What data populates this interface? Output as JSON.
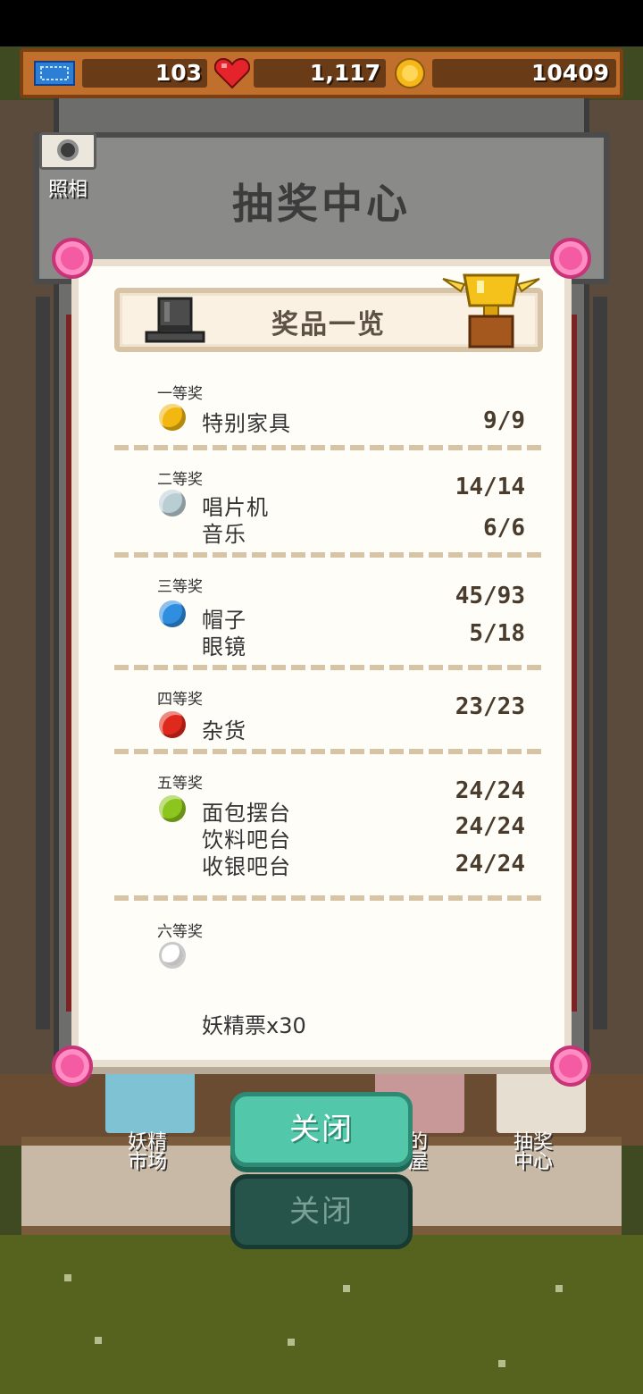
{
  "hud": {
    "tickets": "103",
    "hearts": "1,117",
    "coins": "10409"
  },
  "camera": {
    "label": "照相"
  },
  "scene": {
    "booth_title": "抽奖中心",
    "bottom_left_label": "妖精\n市场",
    "bottom_mid_label": "的\n屋",
    "bottom_right_label": "抽奖\n中心"
  },
  "modal": {
    "title": "奖品一览",
    "tiers": [
      {
        "label": "一等奖",
        "gem_color": "#f2b711",
        "items": [
          {
            "name": "特别家具",
            "count": "9/9"
          }
        ]
      },
      {
        "label": "二等奖",
        "gem_color": "#b9ced3",
        "items": [
          {
            "name": "唱片机",
            "count": "14/14"
          },
          {
            "name": "音乐",
            "count": "6/6"
          }
        ]
      },
      {
        "label": "三等奖",
        "gem_color": "#2f8ee0",
        "items": [
          {
            "name": "帽子",
            "count": "45/93"
          },
          {
            "name": "眼镜",
            "count": "5/18"
          }
        ]
      },
      {
        "label": "四等奖",
        "gem_color": "#e0291d",
        "items": [
          {
            "name": "杂货",
            "count": "23/23"
          }
        ]
      },
      {
        "label": "五等奖",
        "gem_color": "#8cc51d",
        "items": [
          {
            "name": "面包摆台",
            "count": "24/24"
          },
          {
            "name": "饮料吧台",
            "count": "24/24"
          },
          {
            "name": "收银吧台",
            "count": "24/24"
          }
        ]
      },
      {
        "label": "六等奖",
        "gem_color": "#ffffff",
        "items": []
      }
    ],
    "reward_text": "妖精票x30"
  },
  "buttons": {
    "close": "关闭",
    "close_secondary": "关闭"
  },
  "colors": {
    "hud_bar": "#c06f2d",
    "close_button": "#52c7aa",
    "modal_border": "#e9dfd1",
    "divider": "#d7c3a6"
  },
  "icons": {
    "ticket": "ticket-icon",
    "heart": "heart-icon",
    "coin": "coin-icon",
    "camera": "camera-icon",
    "hat": "top-hat-icon",
    "trophy": "trophy-icon"
  }
}
